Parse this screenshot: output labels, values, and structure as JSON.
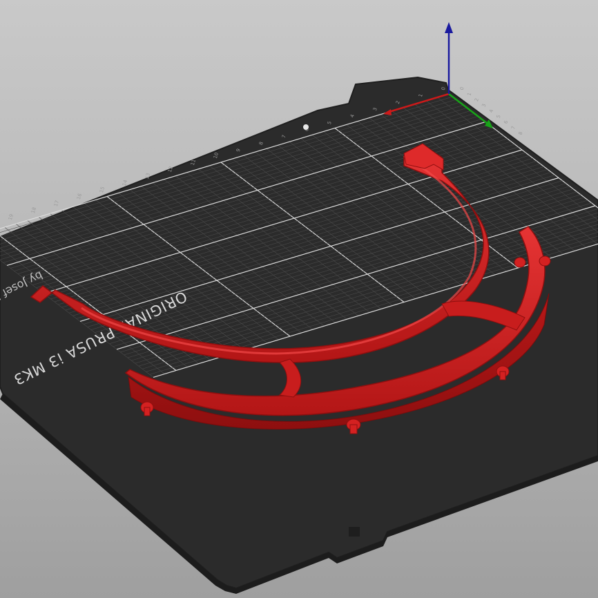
{
  "scene": {
    "view": "3D print bed preview",
    "bed_brand_text": "ORIGINAL PRUSA i3 MK3",
    "bed_brand_sub": "by Josef Prusa",
    "model_name": "face-shield-headband",
    "colors": {
      "background_top": "#c9c9c9",
      "background_bottom": "#9f9f9f",
      "bed": "#2e2e2e",
      "grid_minor": "#4a4a4a",
      "grid_major": "#dcdcdc",
      "model": "#d42121",
      "axis_x": "#cc1a1a",
      "axis_y": "#18a418",
      "axis_z": "#1a1a9e"
    },
    "axes": [
      "x-axis",
      "y-axis",
      "z-axis"
    ],
    "x_ticks": [
      "0",
      "1",
      "2",
      "3",
      "4",
      "5",
      "6",
      "7",
      "8",
      "9",
      "10",
      "11",
      "12",
      "13",
      "14",
      "15",
      "16",
      "17",
      "18",
      "19"
    ],
    "y_ticks": [
      "0",
      "1",
      "2",
      "3",
      "4",
      "5",
      "6",
      "7",
      "8"
    ]
  }
}
